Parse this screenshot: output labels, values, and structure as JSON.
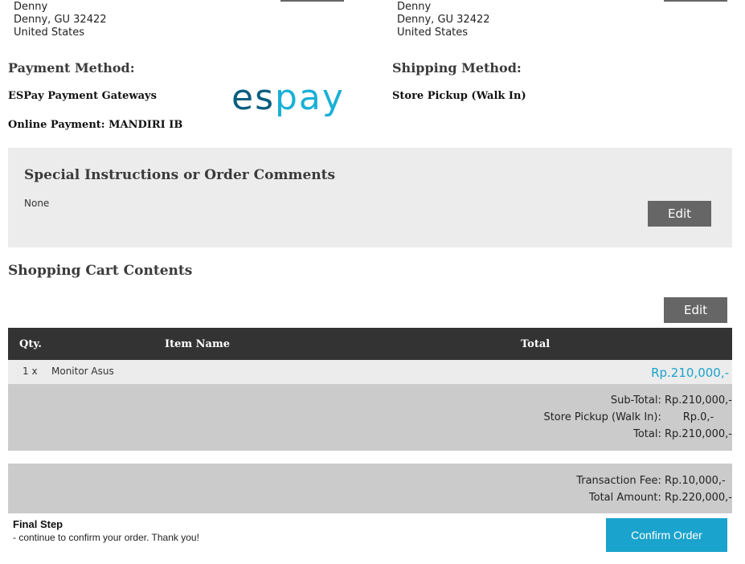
{
  "billing_address": {
    "line1": "Denny",
    "line2": "Denny, GU 32422",
    "line3": "United States"
  },
  "shipping_address": {
    "line1": "Denny",
    "line2": "Denny, GU 32422",
    "line3": "United States"
  },
  "payment": {
    "heading": "Payment Method:",
    "gateway": "ESPay Payment Gateways",
    "online_payment": "Online Payment: MANDIRI IB",
    "logo_text_dark": "es",
    "logo_text_light": "pay",
    "logo_color_dark": "#0a5e7f",
    "logo_color_light": "#1ab0d6"
  },
  "shipping": {
    "heading": "Shipping Method:",
    "method": "Store Pickup (Walk In)"
  },
  "comments": {
    "heading": "Special Instructions or Order Comments",
    "value": "None",
    "edit_label": "Edit"
  },
  "cart": {
    "heading": "Shopping Cart Contents",
    "edit_label": "Edit",
    "columns": [
      "Qty.",
      "Item Name",
      "Total"
    ],
    "items": [
      {
        "qty": "1 x",
        "name": "Monitor Asus",
        "total": "Rp.210,000,-"
      }
    ],
    "total_color": "#1aa3cc"
  },
  "totals": {
    "subtotal_label": "Sub-Total:",
    "subtotal_value": "Rp.210,000,-",
    "shipping_label": "Store Pickup (Walk In):",
    "shipping_value": "Rp.0,-",
    "total_label": "Total:",
    "total_value": "Rp.210,000,-"
  },
  "fees": {
    "fee_label": "Transaction Fee:",
    "fee_value": "Rp.10,000,-",
    "amount_label": "Total Amount:",
    "amount_value": "Rp.220,000,-"
  },
  "final_step": {
    "title": "Final Step",
    "text": "- continue to confirm your order. Thank you!",
    "confirm_label": "Confirm Order"
  }
}
